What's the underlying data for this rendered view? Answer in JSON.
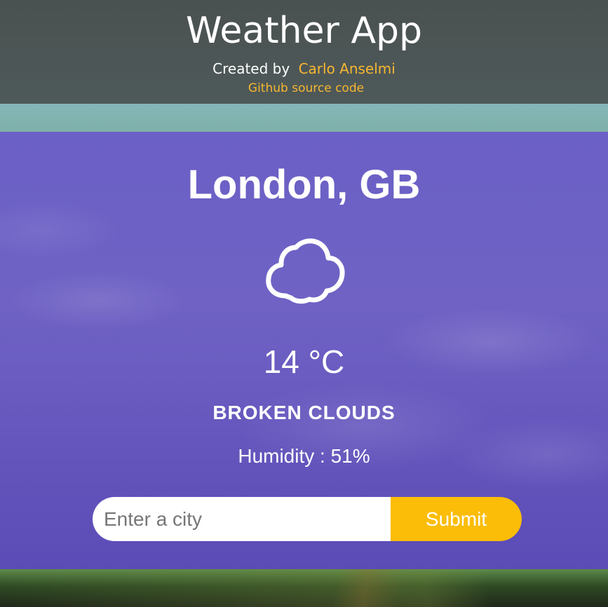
{
  "header": {
    "title": "Weather App",
    "credit_prefix": "Created by",
    "author": "Carlo Anselmi",
    "source_link": "Github source code"
  },
  "weather": {
    "city": "London, GB",
    "icon": "cloud-icon",
    "temperature": "14 °C",
    "condition": "BROKEN CLOUDS",
    "humidity_label": "Humidity",
    "humidity_separator": " : ",
    "humidity_value": "51%"
  },
  "search": {
    "placeholder": "Enter a city",
    "value": "",
    "submit_label": "Submit"
  },
  "colors": {
    "accent": "#fbbd08",
    "link": "#f7b731",
    "card": "#6b60c6",
    "header": "#404040"
  }
}
